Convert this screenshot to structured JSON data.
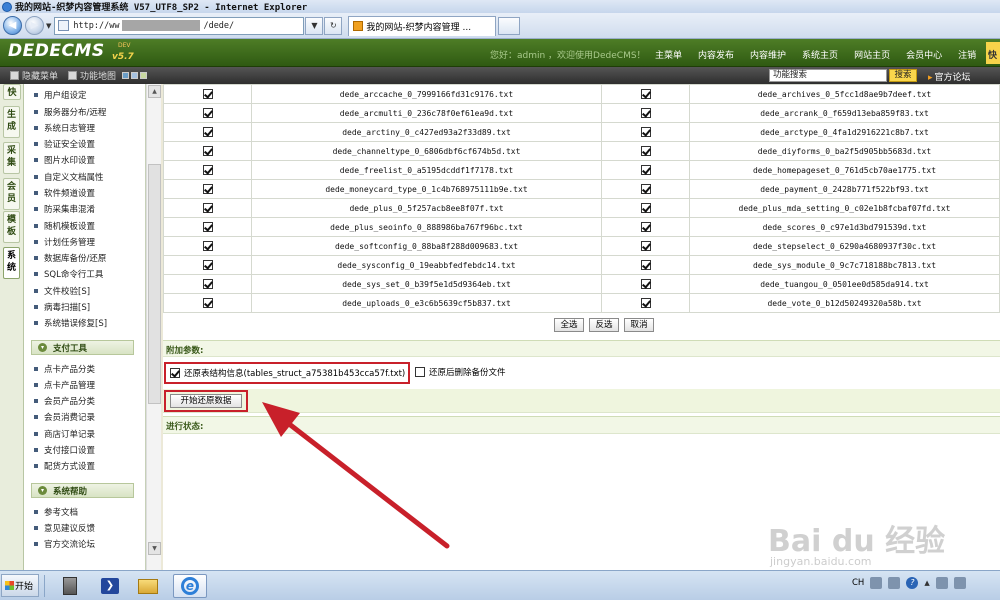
{
  "browser": {
    "title": "我的网站-织梦内容管理系统 V57_UTF8_SP2 - Internet Explorer",
    "address_prefix": "http://ww",
    "address_suffix": "/dede/",
    "tab_label": "我的网站-织梦内容管理 ..."
  },
  "header": {
    "logo": "DEDECMS",
    "logo_version": "v5.7",
    "logo_tag": "DEV",
    "welcome": "您好：admin ，欢迎使用DedeCMS！",
    "nav": [
      "主菜单",
      "内容发布",
      "内容维护",
      "系统主页",
      "网站主页",
      "会员中心",
      "注销"
    ],
    "quick": "快"
  },
  "subbar": {
    "hide_menu": "隐藏菜单",
    "func_map": "功能地图",
    "search_value": "功能搜索",
    "search_btn": "搜索",
    "forum": "官方论坛"
  },
  "vtabs": [
    "快",
    "生成",
    "采集",
    "会员",
    "模板",
    "系统"
  ],
  "menu": {
    "system_items": [
      "用户组设定",
      "服务器分布/远程",
      "系统日志管理",
      "验证安全设置",
      "图片水印设置",
      "自定义文档属性",
      "软件频道设置",
      "防采集串混淆",
      "随机模板设置",
      "计划任务管理",
      "数据库备份/还原",
      "SQL命令行工具",
      "文件校验[S]",
      "病毒扫描[S]",
      "系统错误修复[S]"
    ],
    "pay_header": "支付工具",
    "pay_items": [
      "点卡产品分类",
      "点卡产品管理",
      "会员产品分类",
      "会员消费记录",
      "商店订单记录",
      "支付接口设置",
      "配货方式设置"
    ],
    "help_header": "系统帮助",
    "help_items": [
      "参考文档",
      "意见建议反馈",
      "官方交流论坛"
    ]
  },
  "files": [
    [
      "dede_arccache_0_7999166fd31c9176.txt",
      "dede_archives_0_5fcc1d8ae9b7deef.txt"
    ],
    [
      "dede_arcmulti_0_236c78f0ef61ea9d.txt",
      "dede_arcrank_0_f659d13eba859f83.txt"
    ],
    [
      "dede_arctiny_0_c427ed93a2f33d89.txt",
      "dede_arctype_0_4fa1d2916221c8b7.txt"
    ],
    [
      "dede_channeltype_0_6806dbf6cf674b5d.txt",
      "dede_diyforms_0_ba2f5d905bb5683d.txt"
    ],
    [
      "dede_freelist_0_a5195dcddf1f7178.txt",
      "dede_homepageset_0_761d5cb70ae1775.txt"
    ],
    [
      "dede_moneycard_type_0_1c4b768975111b9e.txt",
      "dede_payment_0_2428b771f522bf93.txt"
    ],
    [
      "dede_plus_0_5f257acb8ee8f07f.txt",
      "dede_plus_mda_setting_0_c02e1b8fcbaf07fd.txt"
    ],
    [
      "dede_plus_seoinfo_0_888986ba767f96bc.txt",
      "dede_scores_0_c97e1d3bd791539d.txt"
    ],
    [
      "dede_softconfig_0_88ba8f288d009683.txt",
      "dede_stepselect_0_6290a4680937f30c.txt"
    ],
    [
      "dede_sysconfig_0_19eabbfedfebdc14.txt",
      "dede_sys_module_0_9c7c718188bc7813.txt"
    ],
    [
      "dede_sys_set_0_b39f5e1d5d9364eb.txt",
      "dede_tuangou_0_0501ee0d585da914.txt"
    ],
    [
      "dede_uploads_0_e3c6b5639cf5b837.txt",
      "dede_vote_0_b12d50249320a58b.txt"
    ]
  ],
  "buttons": {
    "select_all": "全选",
    "invert": "反选",
    "cancel": "取消"
  },
  "params": {
    "header": "附加参数:",
    "restore_struct": "还原表结构信息(tables_struct_a75381b453cca57f.txt)",
    "delete_backup": "还原后删除备份文件",
    "start": "开始还原数据",
    "progress_header": "进行状态:"
  },
  "watermark": {
    "main": "Bai du 经验",
    "url": "jingyan.baidu.com"
  },
  "taskbar": {
    "start": "开始",
    "lang": "CH"
  }
}
